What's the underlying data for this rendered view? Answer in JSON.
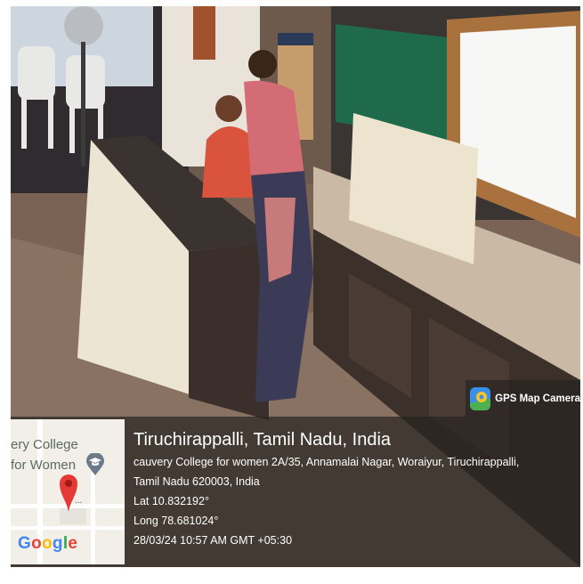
{
  "scene": {
    "description_icon": "classroom-photo"
  },
  "badge": {
    "label": "GPS Map Camera",
    "icon": "gps-map-camera-app-icon"
  },
  "map": {
    "label_line1": "ery College",
    "label_line2": "for Women",
    "google_letters": [
      "G",
      "o",
      "o",
      "g",
      "l",
      "e"
    ],
    "pin_icon": "map-pin-icon",
    "poi_icon": "graduation-cap-icon",
    "dots": "..."
  },
  "info": {
    "city": "Tiruchirappalli, Tamil Nadu, India",
    "address_line1": "cauvery College for women 2A/35, Annamalai Nagar, Woraiyur, Tiruchirappalli,",
    "address_line2": "Tamil Nadu 620003, India",
    "lat": "Lat 10.832192°",
    "long": "Long 78.681024°",
    "datetime": "28/03/24 10:57 AM GMT +05:30"
  },
  "colors": {
    "overlay": "#282422",
    "pin": "#e53935",
    "google_blue": "#4285f4",
    "google_red": "#ea4335",
    "google_yellow": "#fbbc05",
    "google_green": "#34a853"
  }
}
